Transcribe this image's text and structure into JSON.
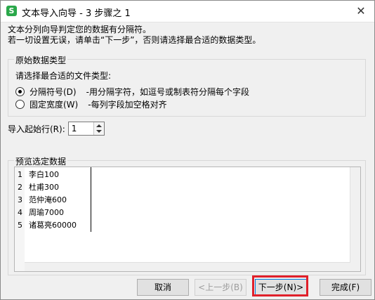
{
  "window": {
    "title": "文本导入向导 - 3 步骤之 1",
    "app_icon": "S",
    "close_symbol": "✕"
  },
  "intro": {
    "line1": "文本分列向导判定您的数据有分隔符。",
    "line2": "若一切设置无误，请单击“下一步”，否则请选择最合适的数据类型。"
  },
  "data_type_group": {
    "legend": "原始数据类型",
    "prompt": "请选择最合适的文件类型:",
    "options": [
      {
        "label": "分隔符号(D)",
        "desc": "-用分隔字符，如逗号或制表符分隔每个字段",
        "checked": true
      },
      {
        "label": "固定宽度(W)",
        "desc": "-每列字段加空格对齐",
        "checked": false
      }
    ]
  },
  "start_row": {
    "label": "导入起始行(R):",
    "value": "1"
  },
  "preview_group": {
    "legend": "预览选定数据",
    "rows": [
      {
        "num": "1",
        "text": "李白100"
      },
      {
        "num": "2",
        "text": "杜甫300"
      },
      {
        "num": "3",
        "text": "范仲淹600"
      },
      {
        "num": "4",
        "text": "周瑜7000"
      },
      {
        "num": "5",
        "text": "诸葛亮60000"
      }
    ]
  },
  "buttons": {
    "cancel": "取消",
    "back": "<上一步(B)",
    "next": "下一步(N)>",
    "finish": "完成(F)"
  },
  "colors": {
    "highlight": "#e0202a",
    "app_icon": "#2aa84a"
  }
}
